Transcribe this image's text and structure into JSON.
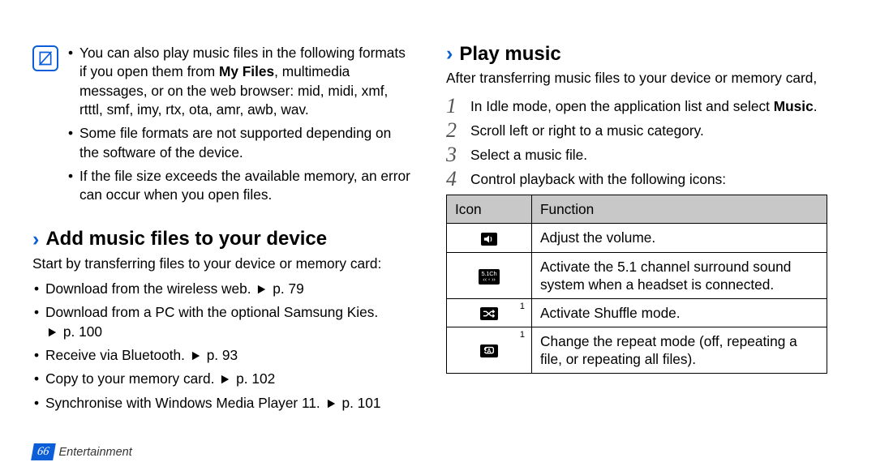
{
  "left": {
    "info_bullets": [
      {
        "pre": "You can also play music files in the following formats if you open them from ",
        "bold": "My Files",
        "post": ", multimedia messages, or on the web browser: mid, midi, xmf, rtttl, smf, imy, rtx, ota, amr, awb, wav."
      },
      {
        "text": "Some file formats are not supported depending on the software of the device."
      },
      {
        "text": "If the file size exceeds the available memory, an error can occur when you open files."
      }
    ],
    "subhead": "Add music files to your device",
    "intro": "Start by transferring files to your device or memory card:",
    "items": [
      {
        "text": "Download from the wireless web. ",
        "ref": "p. 79"
      },
      {
        "text": "Download from a PC with the optional Samsung Kies. ",
        "ref": "p. 100",
        "ref_newline": true
      },
      {
        "text": "Receive via Bluetooth. ",
        "ref": "p. 93"
      },
      {
        "text": "Copy to your memory card. ",
        "ref": "p. 102"
      },
      {
        "text": "Synchronise with Windows Media Player 11. ",
        "ref": "p. 101"
      }
    ]
  },
  "right": {
    "subhead": "Play music",
    "intro": "After transferring music files to your device or memory card,",
    "steps": [
      {
        "pre": "In Idle mode, open the application list and select ",
        "bold": "Music",
        "post": "."
      },
      {
        "text": "Scroll left or right to a music category."
      },
      {
        "text": "Select a music file."
      },
      {
        "text": "Control playback with the following icons:"
      }
    ],
    "table": {
      "headers": {
        "icon": "Icon",
        "func": "Function"
      },
      "rows": [
        {
          "icon": "speaker",
          "func": "Adjust the volume."
        },
        {
          "icon": "fiveone",
          "label": "5.1Ch",
          "func": "Activate the 5.1 channel surround sound system when a headset is connected."
        },
        {
          "icon": "shuffle",
          "sup": "1",
          "func": "Activate Shuffle mode."
        },
        {
          "icon": "repeat",
          "sup": "1",
          "func": "Change the repeat mode (off, repeating a file, or repeating all files)."
        }
      ]
    }
  },
  "footer": {
    "page": "66",
    "section": "Entertainment"
  }
}
